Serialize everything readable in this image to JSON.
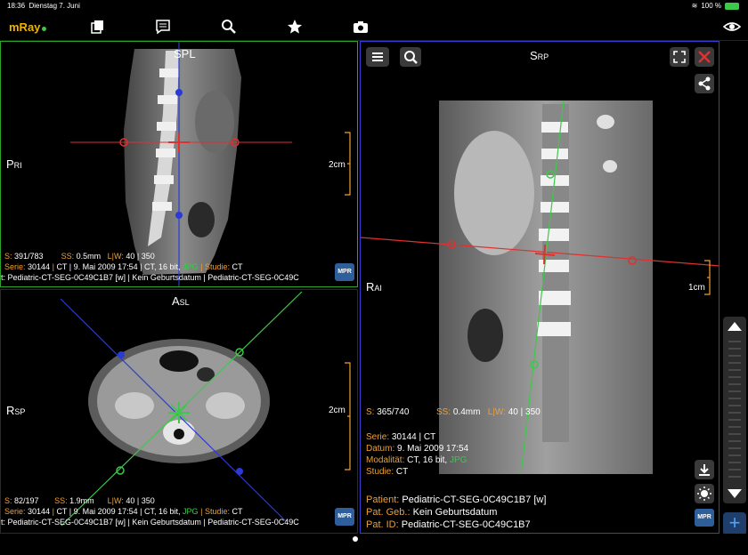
{
  "statusbar": {
    "time": "18:36",
    "date": "Dienstag 7. Juni",
    "battery": "100 %"
  },
  "app": {
    "logo": "mRay"
  },
  "toolbar": {
    "icons": [
      "series-icon",
      "comments-icon",
      "search-icon",
      "star-icon",
      "camera-icon",
      "eye-icon"
    ]
  },
  "viewer_tl": {
    "top_label": "SPL",
    "left_label_main": "P",
    "left_label_sub": "RI",
    "scale": "2cm",
    "slice_k": "S:",
    "slice_v": "391/783",
    "ss_k": "SS:",
    "ss_v": "0.5mm",
    "lw_k": "L|W:",
    "lw_v": "40 | 350",
    "serie_k": "Serie:",
    "serie_v": "30144",
    "serie_rest": "CT | 9. Mai 2009 17:54 | CT, 16 bit,",
    "jpg": "JPG",
    "studie_k": "Studie:",
    "studie_v": "CT",
    "patient_line": "t: Pediatric-CT-SEG-0C49C1B7 [w] | Kein Geburtsdatum | Pediatric-CT-SEG-0C49C",
    "mpr": "MPR"
  },
  "viewer_bl": {
    "top_label_main": "A",
    "top_label_sub": "SL",
    "left_label_main": "R",
    "left_label_sub": "SP",
    "scale": "2cm",
    "slice_k": "S:",
    "slice_v": "82/197",
    "ss_k": "SS:",
    "ss_v": "1.9mm",
    "lw_k": "L|W:",
    "lw_v": "40 | 350",
    "serie_k": "Serie:",
    "serie_v": "30144",
    "serie_rest": "CT | 9. Mai 2009 17:54 | CT, 16 bit,",
    "jpg": "JPG",
    "studie_k": "Studie:",
    "studie_v": "CT",
    "patient_line": "t: Pediatric-CT-SEG-0C49C1B7 [w] | Kein Geburtsdatum | Pediatric-CT-SEG-0C49C",
    "mpr": "MPR"
  },
  "viewer_r": {
    "top_label_main": "S",
    "top_label_sub": "RP",
    "left_label_main": "R",
    "left_label_sub": "AI",
    "scale": "1cm",
    "slice_k": "S:",
    "slice_v": "365/740",
    "ss_k": "SS:",
    "ss_v": "0.4mm",
    "lw_k": "L|W:",
    "lw_v": "40 | 350",
    "serie_k": "Serie:",
    "serie_v": "30144 | CT",
    "datum_k": "Datum:",
    "datum_v": "9. Mai 2009 17:54",
    "modal_k": "Modalität:",
    "modal_v": "CT, 16 bit,",
    "jpg": "JPG",
    "studie_k": "Studie:",
    "studie_v": "CT",
    "patient_k": "Patient:",
    "patient_v": "Pediatric-CT-SEG-0C49C1B7 [w]",
    "geb_k": "Pat. Geb.:",
    "geb_v": "Kein Geburtsdatum",
    "id_k": "Pat. ID:",
    "id_v": "Pediatric-CT-SEG-0C49C1B7",
    "mpr": "MPR"
  },
  "colors": {
    "accent": "#f0a030",
    "red_line": "#e03030",
    "blue_line": "#2a3ad6",
    "green_line": "#3cc84a",
    "mpr": "#2e5f9a"
  }
}
